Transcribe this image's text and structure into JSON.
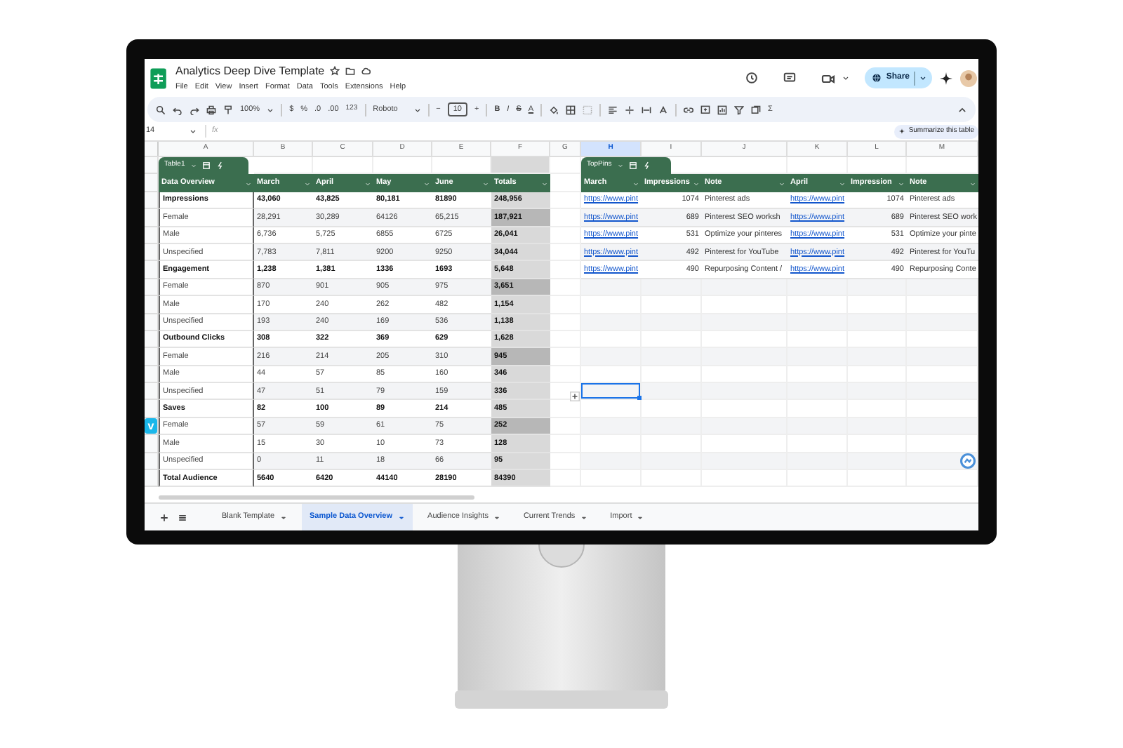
{
  "document": {
    "title": "Analytics Deep Dive Template"
  },
  "menu": [
    "File",
    "Edit",
    "View",
    "Insert",
    "Format",
    "Data",
    "Tools",
    "Extensions",
    "Help"
  ],
  "share": {
    "label": "Share"
  },
  "toolbar": {
    "zoom": "100%",
    "currency": "$",
    "percent": "%",
    "decrease_decimals": ".0",
    "increase_decimals": ".00",
    "number_format": "123",
    "font": "Roboto",
    "size_minus": "−",
    "font_size": "10",
    "size_plus": "+",
    "bold": "B",
    "italic": "I",
    "strikethrough": "S",
    "text_color": "A",
    "functions": "Σ"
  },
  "name_box": "14",
  "formula_label": "fx",
  "summarize": {
    "label": "Summarize this table"
  },
  "columns": [
    {
      "label": "A",
      "selected": false
    },
    {
      "label": "B",
      "selected": false
    },
    {
      "label": "C",
      "selected": false
    },
    {
      "label": "D",
      "selected": false
    },
    {
      "label": "E",
      "selected": false
    },
    {
      "label": "F",
      "selected": false
    },
    {
      "label": "G",
      "selected": false
    },
    {
      "label": "H",
      "selected": true
    },
    {
      "label": "I",
      "selected": false
    },
    {
      "label": "J",
      "selected": false
    },
    {
      "label": "K",
      "selected": false
    },
    {
      "label": "L",
      "selected": false
    },
    {
      "label": "M",
      "selected": false
    }
  ],
  "tables": [
    {
      "name": "Table1",
      "headers": [
        "Data Overview",
        "March",
        "April",
        "May",
        "June",
        "Totals"
      ],
      "rows": [
        {
          "kind": "group",
          "highlight": false,
          "cells": [
            "Impressions",
            "43,060",
            "43,825",
            "80,181",
            "81890",
            "248,956"
          ]
        },
        {
          "kind": "item",
          "highlight": true,
          "cells": [
            "Female",
            "28,291",
            "30,289",
            "64126",
            "65,215",
            "187,921"
          ]
        },
        {
          "kind": "item",
          "highlight": false,
          "cells": [
            "Male",
            "6,736",
            "5,725",
            "6855",
            "6725",
            "26,041"
          ]
        },
        {
          "kind": "item",
          "highlight": false,
          "cells": [
            "Unspecified",
            "7,783",
            "7,811",
            "9200",
            "9250",
            "34,044"
          ]
        },
        {
          "kind": "group",
          "highlight": false,
          "cells": [
            "Engagement",
            "1,238",
            "1,381",
            "1336",
            "1693",
            "5,648"
          ]
        },
        {
          "kind": "item",
          "highlight": true,
          "cells": [
            "Female",
            "870",
            "901",
            "905",
            "975",
            "3,651"
          ]
        },
        {
          "kind": "item",
          "highlight": false,
          "cells": [
            "Male",
            "170",
            "240",
            "262",
            "482",
            "1,154"
          ]
        },
        {
          "kind": "item",
          "highlight": false,
          "cells": [
            "Unspecified",
            "193",
            "240",
            "169",
            "536",
            "1,138"
          ]
        },
        {
          "kind": "group",
          "highlight": false,
          "cells": [
            "Outbound Clicks",
            "308",
            "322",
            "369",
            "629",
            "1,628"
          ]
        },
        {
          "kind": "item",
          "highlight": true,
          "cells": [
            "Female",
            "216",
            "214",
            "205",
            "310",
            "945"
          ]
        },
        {
          "kind": "item",
          "highlight": false,
          "cells": [
            "Male",
            "44",
            "57",
            "85",
            "160",
            "346"
          ]
        },
        {
          "kind": "item",
          "highlight": false,
          "cells": [
            "Unspecified",
            "47",
            "51",
            "79",
            "159",
            "336"
          ]
        },
        {
          "kind": "group",
          "highlight": false,
          "cells": [
            "Saves",
            "82",
            "100",
            "89",
            "214",
            "485"
          ]
        },
        {
          "kind": "item",
          "highlight": true,
          "cells": [
            "Female",
            "57",
            "59",
            "61",
            "75",
            "252"
          ]
        },
        {
          "kind": "item",
          "highlight": false,
          "cells": [
            "Male",
            "15",
            "30",
            "10",
            "73",
            "128"
          ]
        },
        {
          "kind": "item",
          "highlight": false,
          "cells": [
            "Unspecified",
            "0",
            "11",
            "18",
            "66",
            "95"
          ]
        },
        {
          "kind": "group",
          "highlight": false,
          "cells": [
            "Total Audience",
            "5640",
            "6420",
            "44140",
            "28190",
            "84390"
          ]
        }
      ]
    },
    {
      "name": "TopPins",
      "headers": [
        "March",
        "Impressions",
        "Note",
        "April",
        "Impression",
        "Note"
      ],
      "rows": [
        {
          "cells": [
            "https://www.pint",
            "1074",
            "Pinterest ads",
            "https://www.pint",
            "1074",
            "Pinterest ads"
          ]
        },
        {
          "cells": [
            "https://www.pint",
            "689",
            "Pinterest SEO worksh",
            "https://www.pint",
            "689",
            "Pinterest SEO work"
          ]
        },
        {
          "cells": [
            "https://www.pint",
            "531",
            "Optimize your pinteres",
            "https://www.pint",
            "531",
            "Optimize your pinte"
          ]
        },
        {
          "cells": [
            "https://www.pint",
            "492",
            "Pinterest for YouTube",
            "https://www.pint",
            "492",
            "Pinterest for YouTu"
          ]
        },
        {
          "cells": [
            "https://www.pint",
            "490",
            "Repurposing Content /",
            "https://www.pint",
            "490",
            "Repurposing Conte"
          ]
        }
      ]
    }
  ],
  "badge": "v",
  "sheet_tabs": [
    {
      "label": "Blank Template",
      "selected": false
    },
    {
      "label": "Sample Data Overview",
      "selected": true
    },
    {
      "label": "Audience Insights",
      "selected": false
    },
    {
      "label": "Current Trends",
      "selected": false
    },
    {
      "label": "Import",
      "selected": false
    }
  ]
}
